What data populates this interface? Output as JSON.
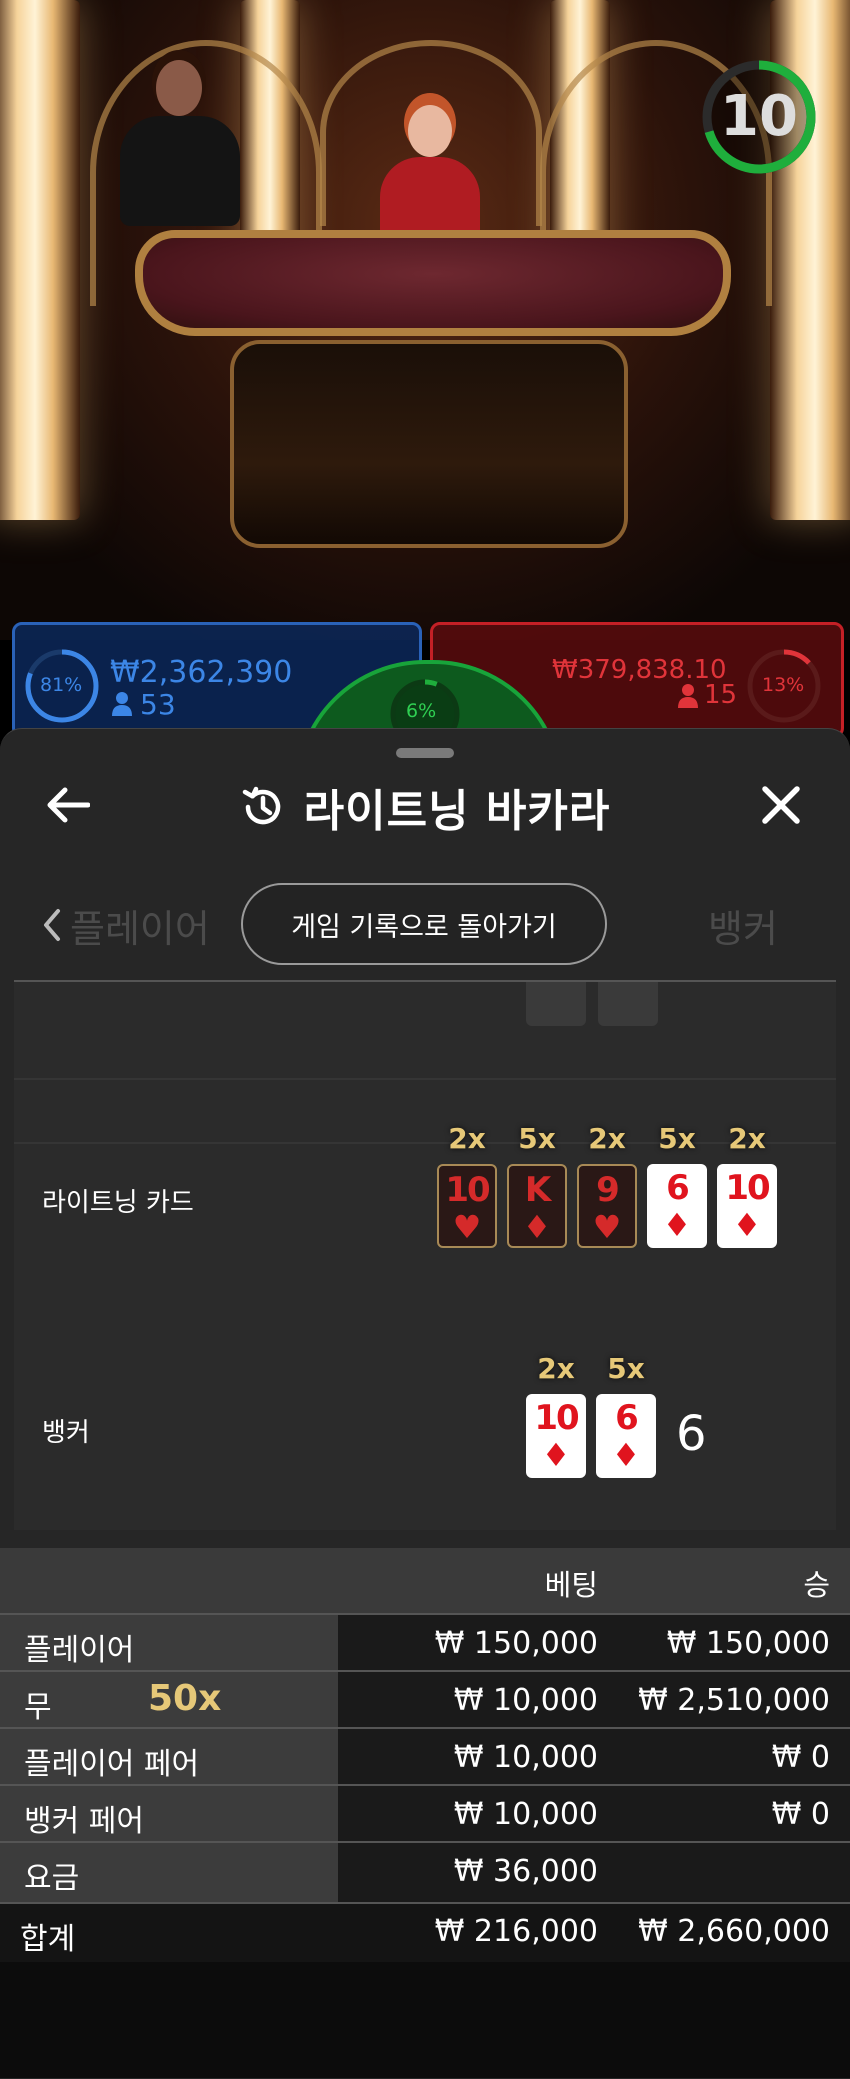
{
  "video": {
    "timer": "10",
    "player_panel": {
      "percent": "81%",
      "amount": "₩2,362,390",
      "count": "53"
    },
    "banker_panel": {
      "percent": "13%",
      "amount": "₩379,838.10",
      "count": "15"
    },
    "tie_panel": {
      "percent": "6%"
    }
  },
  "header": {
    "title": "라이트닝 바카라"
  },
  "history": {
    "return_label": "게임 기록으로 돌아가기",
    "ghost_left": "플레이어",
    "ghost_right": "뱅커"
  },
  "lightning": {
    "label": "라이트닝 카드",
    "cards": [
      {
        "rank": "10",
        "suit": "♥",
        "mult": "2x",
        "active": false
      },
      {
        "rank": "K",
        "suit": "♦",
        "mult": "5x",
        "active": false
      },
      {
        "rank": "9",
        "suit": "♥",
        "mult": "2x",
        "active": false
      },
      {
        "rank": "6",
        "suit": "♦",
        "mult": "5x",
        "active": true
      },
      {
        "rank": "10",
        "suit": "♦",
        "mult": "2x",
        "active": true
      }
    ]
  },
  "banker_hand": {
    "label": "뱅커",
    "cards": [
      {
        "rank": "10",
        "suit": "♦",
        "mult": "2x"
      },
      {
        "rank": "6",
        "suit": "♦",
        "mult": "5x"
      }
    ],
    "score": "6"
  },
  "bets": {
    "col_bet": "베팅",
    "col_win": "승",
    "rows": [
      {
        "label": "플레이어",
        "bet": "₩ 150,000",
        "win": "₩ 150,000"
      },
      {
        "label": "무",
        "mult": "50x",
        "bet": "₩ 10,000",
        "win": "₩ 2,510,000"
      },
      {
        "label": "플레이어 페어",
        "bet": "₩ 10,000",
        "win": "₩ 0"
      },
      {
        "label": "뱅커 페어",
        "bet": "₩ 10,000",
        "win": "₩ 0"
      },
      {
        "label": "요금",
        "bet": "₩ 36,000",
        "win": ""
      }
    ],
    "total": {
      "label": "합계",
      "bet": "₩ 216,000",
      "win": "₩ 2,660,000"
    }
  },
  "colors": {
    "player": "#2a62b8",
    "banker": "#c42026",
    "tie": "#18a43a",
    "multiplier": "#e6c878"
  },
  "icons": [
    "arrow-left-icon",
    "history-icon",
    "close-icon",
    "chevron-left-icon"
  ]
}
